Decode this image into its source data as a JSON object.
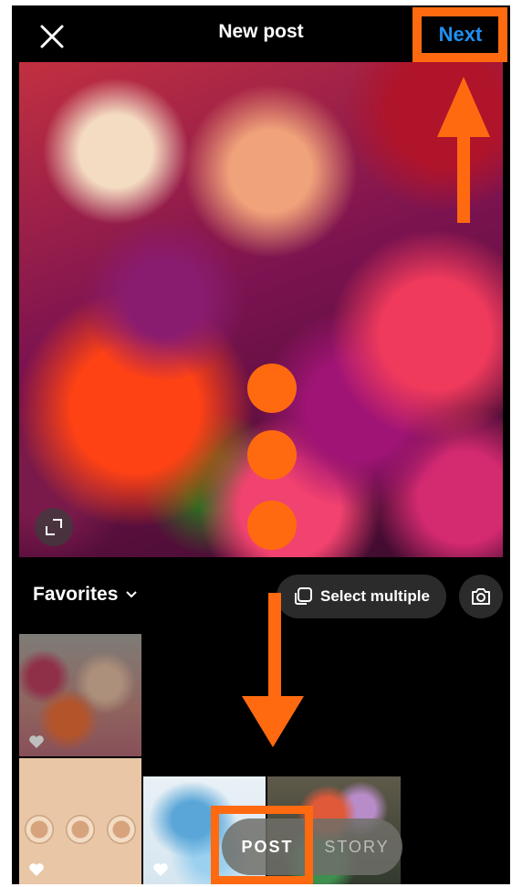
{
  "header": {
    "title": "New post",
    "next_label": "Next",
    "close_icon": "close-icon"
  },
  "gallery": {
    "album_label": "Favorites",
    "select_multiple_label": "Select multiple",
    "camera_icon": "camera-icon"
  },
  "modes": {
    "post_label": "POST",
    "story_label": "STORY"
  },
  "colors": {
    "accent_blue": "#1f8ff0",
    "annotation_orange": "#ff6a10",
    "background": "#000000"
  }
}
